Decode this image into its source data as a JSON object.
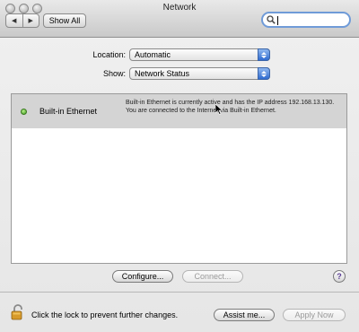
{
  "window": {
    "title": "Network"
  },
  "toolbar": {
    "back_glyph": "◀",
    "forward_glyph": "▶",
    "show_all_label": "Show All",
    "search_value": "",
    "search_placeholder": ""
  },
  "location": {
    "label": "Location:",
    "value": "Automatic"
  },
  "show": {
    "label": "Show:",
    "value": "Network Status"
  },
  "services": [
    {
      "name": "Built-in Ethernet",
      "status": "active",
      "status_color": "#3d9b1f",
      "description": "Built-in Ethernet is currently active and has the IP address 192.168.13.130. You are connected to the Internet via Built-in Ethernet."
    }
  ],
  "actions": {
    "configure_label": "Configure...",
    "connect_label": "Connect...",
    "help_label": "?"
  },
  "footer": {
    "lock_text": "Click the lock to prevent further changes.",
    "assist_label": "Assist me...",
    "apply_label": "Apply Now"
  },
  "icons": [
    "back-icon",
    "forward-icon",
    "search-icon",
    "popup-arrows-icon",
    "status-dot-icon",
    "lock-icon",
    "pointer-cursor-icon"
  ]
}
